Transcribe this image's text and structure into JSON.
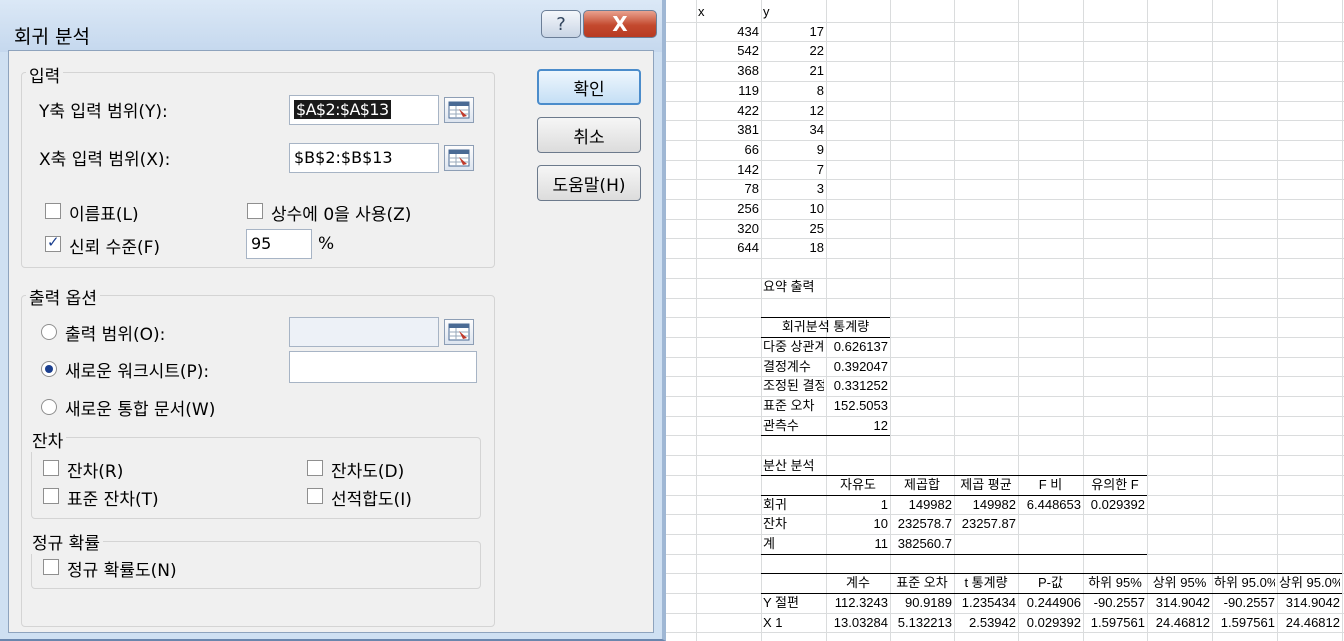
{
  "dialog": {
    "title": "회귀 분석",
    "help_label": "?",
    "close_label": "X",
    "input_section": {
      "legend": "입력",
      "y_range_label": "Y축 입력 범위(Y):",
      "y_range_value": "$A$2:$A$13",
      "x_range_label": "X축 입력 범위(X):",
      "x_range_value": "$B$2:$B$13",
      "labels_checkbox": "이름표(L)",
      "constant_zero_checkbox": "상수에 0을 사용(Z)",
      "confidence_checkbox": "신뢰 수준(F)",
      "confidence_value": "95",
      "confidence_unit": "%"
    },
    "output_section": {
      "legend": "출력 옵션",
      "output_range_label": "출력 범위(O):",
      "new_sheet_label": "새로운 워크시트(P):",
      "new_workbook_label": "새로운 통합 문서(W)",
      "residuals_legend": "잔차",
      "residuals_label": "잔차(R)",
      "std_residuals_label": "표준 잔차(T)",
      "residual_plots_label": "잔차도(D)",
      "line_fit_label": "선적합도(I)",
      "normal_legend": "정규 확률",
      "normal_plot_label": "정규 확률도(N)"
    },
    "buttons": {
      "ok": "확인",
      "cancel": "취소",
      "help": "도움말(H)"
    }
  },
  "sheet": {
    "headers": {
      "x": "x",
      "y": "y"
    },
    "data": [
      [
        "434",
        "17"
      ],
      [
        "542",
        "22"
      ],
      [
        "368",
        "21"
      ],
      [
        "119",
        "8"
      ],
      [
        "422",
        "12"
      ],
      [
        "381",
        "34"
      ],
      [
        "66",
        "9"
      ],
      [
        "142",
        "7"
      ],
      [
        "78",
        "3"
      ],
      [
        "256",
        "10"
      ],
      [
        "320",
        "25"
      ],
      [
        "644",
        "18"
      ]
    ],
    "summary_title": "요약 출력",
    "reg_stats_header": [
      "회귀분석 통계량",
      ""
    ],
    "reg_stats": [
      [
        "다중 상관계수",
        "0.626137"
      ],
      [
        "결정계수",
        "0.392047"
      ],
      [
        "조정된 결정계수",
        "0.331252"
      ],
      [
        "표준 오차",
        "152.5053"
      ],
      [
        "관측수",
        "12"
      ]
    ],
    "anova_title": "분산 분석",
    "anova_header": [
      "",
      "자유도",
      "제곱합",
      "제곱 평균",
      "F 비",
      "유의한 F"
    ],
    "anova_rows": [
      [
        "회귀",
        "1",
        "149982",
        "149982",
        "6.448653",
        "0.029392"
      ],
      [
        "잔차",
        "10",
        "232578.7",
        "23257.87",
        "",
        ""
      ],
      [
        "계",
        "11",
        "382560.7",
        "",
        "",
        ""
      ]
    ],
    "coef_header": [
      "",
      "계수",
      "표준 오차",
      "t 통계량",
      "P-값",
      "하위 95%",
      "상위 95%",
      "하위 95.0%",
      "상위 95.0%"
    ],
    "coef_rows": [
      [
        "Y 절편",
        "112.3243",
        "90.9189",
        "1.235434",
        "0.244906",
        "-90.2557",
        "314.9042",
        "-90.2557",
        "314.9042"
      ],
      [
        "X 1",
        "13.03284",
        "5.132213",
        "2.53942",
        "0.029392",
        "1.597561",
        "24.46812",
        "1.597561",
        "24.46812"
      ]
    ]
  }
}
